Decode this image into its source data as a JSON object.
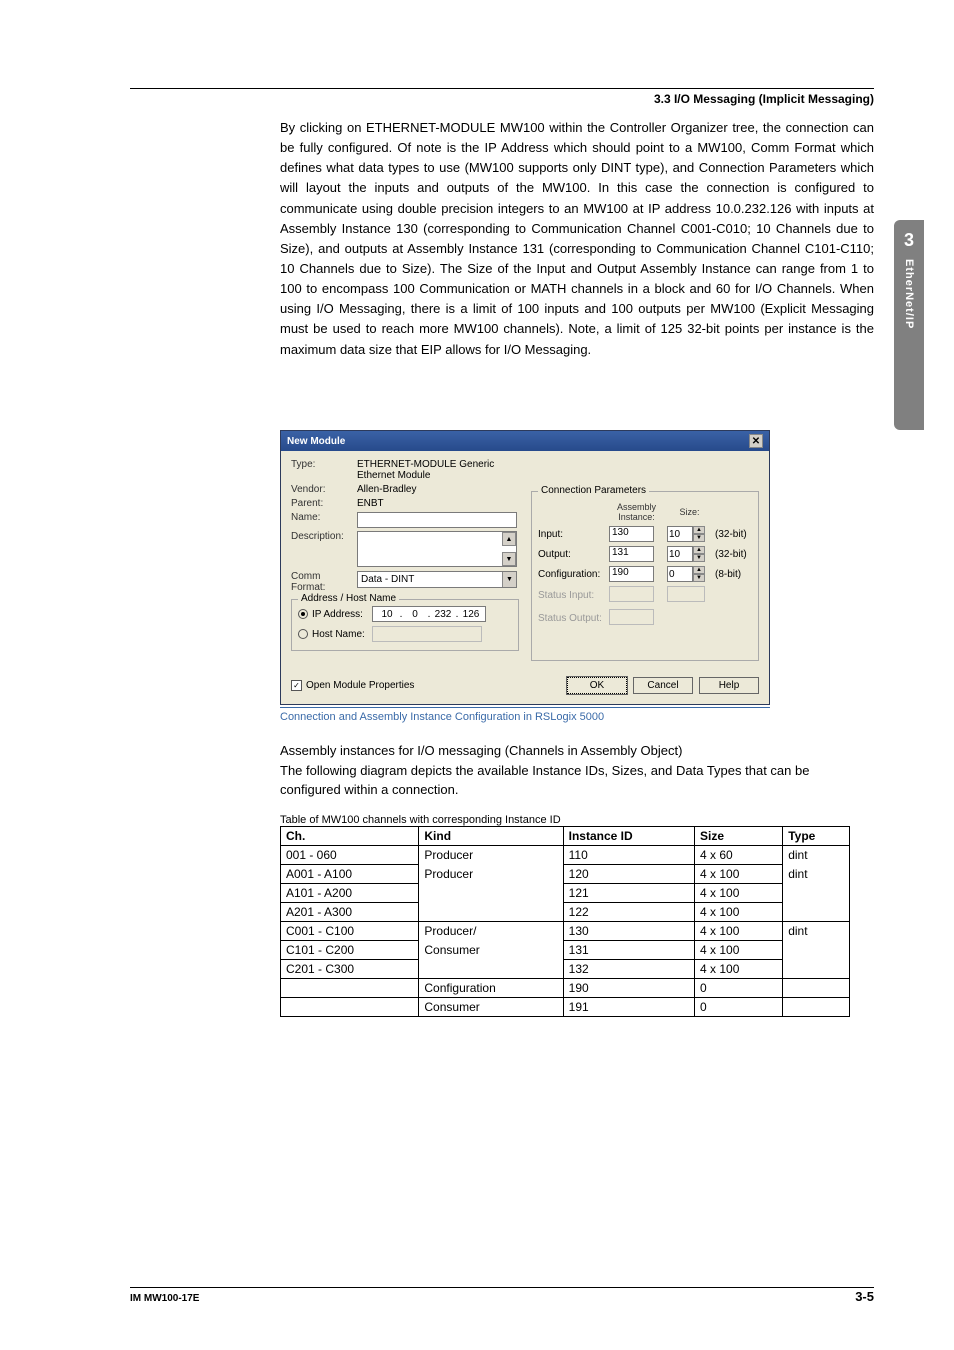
{
  "header": {
    "section": "3.3  I/O Messaging (Implicit Messaging)"
  },
  "sidebar": {
    "chapter_num": "3",
    "chapter_title": "EtherNet/IP"
  },
  "paragraph": "By clicking on ETHERNET-MODULE MW100 within the Controller Organizer tree, the connection can be fully configured. Of note is the IP Address which should point to a MW100, Comm Format which defines what data types to use (MW100 supports only DINT type), and Connection Parameters which will layout the inputs and outputs of the MW100. In this case the connection is configured to communicate using double precision integers to an MW100 at IP address 10.0.232.126 with inputs at Assembly Instance 130 (corresponding to Communication Channel C001-C010; 10 Channels due to Size), and outputs at Assembly Instance 131 (corresponding to Communication Channel C101-C110; 10 Channels due to Size). The Size of the Input and Output Assembly Instance can range from 1 to 100 to encompass 100 Communication or MATH channels in a block and 60 for I/O Channels. When using I/O Messaging, there is a limit of 100 inputs and 100 outputs per MW100 (Explicit Messaging must be used to reach more MW100 channels). Note, a limit of 125 32-bit points per instance is the maximum data size that EIP allows for I/O Messaging.",
  "dialog": {
    "title": "New Module",
    "labels": {
      "type": "Type:",
      "vendor": "Vendor:",
      "parent": "Parent:",
      "name": "Name:",
      "description": "Description:",
      "comm_format": "Comm Format:",
      "address_host": "Address / Host Name",
      "ip_address": "IP Address:",
      "host_name": "Host Name:",
      "conn_params": "Connection Parameters",
      "assembly_instance": "Assembly\nInstance:",
      "size": "Size:",
      "input": "Input:",
      "output": "Output:",
      "configuration": "Configuration:",
      "status_input": "Status Input:",
      "status_output": "Status Output:",
      "open_props": "Open Module Properties"
    },
    "values": {
      "type": "ETHERNET-MODULE Generic Ethernet Module",
      "vendor": "Allen-Bradley",
      "parent": "ENBT",
      "comm_format": "Data - DINT",
      "ip": [
        "10",
        "0",
        "232",
        "126"
      ],
      "input_instance": "130",
      "input_size": "10",
      "input_bits": "(32-bit)",
      "output_instance": "131",
      "output_size": "10",
      "output_bits": "(32-bit)",
      "config_instance": "190",
      "config_size": "0",
      "config_bits": "(8-bit)"
    },
    "buttons": {
      "ok": "OK",
      "cancel": "Cancel",
      "help": "Help"
    }
  },
  "caption": "Connection and Assembly Instance Configuration in RSLogix 5000",
  "subheading": "Assembly instances for I/O messaging (Channels in Assembly Object)",
  "subparagraph": "The following diagram depicts the available Instance IDs, Sizes, and Data Types that can be configured within a connection.",
  "table_caption": "Table of MW100 channels with corresponding Instance ID",
  "table": {
    "headers": [
      "Ch.",
      "Kind",
      "Instance ID",
      "Size",
      "Type"
    ],
    "rows": [
      {
        "ch": "001 - 060",
        "kind": "Producer",
        "id": "110",
        "size": "4 x 60",
        "type": "dint",
        "kind_border": "bottom",
        "type_border": "bottom"
      },
      {
        "ch": "A001 - A100",
        "kind": "Producer",
        "id": "120",
        "size": "4 x 100",
        "type": "dint",
        "kind_border": "none",
        "type_border": "none"
      },
      {
        "ch": "A101 - A200",
        "kind": "",
        "id": "121",
        "size": "4 x 100",
        "type": "",
        "kind_border": "none",
        "type_border": "none"
      },
      {
        "ch": "A201 - A300",
        "kind": "",
        "id": "122",
        "size": "4 x 100",
        "type": "",
        "kind_border": "top",
        "type_border": "top"
      },
      {
        "ch": "C001 - C100",
        "kind": "Producer/",
        "id": "130",
        "size": "4 x 100",
        "type": "dint",
        "kind_border": "none",
        "type_border": "none"
      },
      {
        "ch": "C101 - C200",
        "kind": "Consumer",
        "id": "131",
        "size": "4 x 100",
        "type": "",
        "kind_border": "none",
        "type_border": "none"
      },
      {
        "ch": "C201 - C300",
        "kind": "",
        "id": "132",
        "size": "4 x 100",
        "type": "",
        "kind_border": "top",
        "type_border": "top"
      },
      {
        "ch": "",
        "kind": "Configuration",
        "id": "190",
        "size": "0",
        "type": "",
        "kind_border": "both",
        "type_border": "both"
      },
      {
        "ch": "",
        "kind": "Consumer",
        "id": "191",
        "size": "0",
        "type": "",
        "kind_border": "both",
        "type_border": "both"
      }
    ]
  },
  "footer": {
    "left": "IM MW100-17E",
    "right": "3-5"
  }
}
